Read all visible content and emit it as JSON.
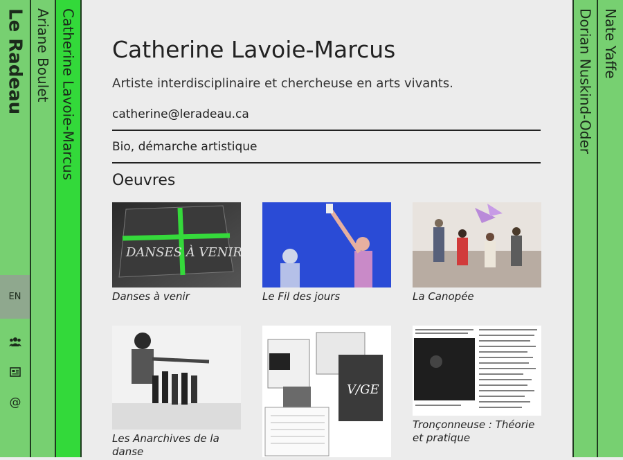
{
  "site": {
    "brand": "Le Radeau",
    "lang": "EN"
  },
  "columns": {
    "left": [
      "Ariane Boulet",
      "Catherine Lavoie-Marcus"
    ],
    "right": [
      "Dorian Nuskind-Oder",
      "Nate Yaffe"
    ]
  },
  "sidebar_icons": [
    "people-icon",
    "newspaper-icon",
    "at-icon"
  ],
  "profile": {
    "name": "Catherine Lavoie-Marcus",
    "subtitle": "Artiste interdisciplinaire et chercheuse en arts vivants.",
    "email": "catherine@leradeau.ca",
    "bio_link": "Bio, démarche artistique",
    "works_heading": "Oeuvres"
  },
  "works": [
    {
      "title": "Danses à venir"
    },
    {
      "title": "Le Fil des jours"
    },
    {
      "title": "La Canopée"
    },
    {
      "title": "Les Anarchives de la danse"
    },
    {
      "title": ""
    },
    {
      "title": "Tronçonneuse : Théorie et pratique"
    }
  ],
  "colors": {
    "green_light": "#77d071",
    "green_bright": "#33d93a",
    "bg": "#ececec"
  }
}
